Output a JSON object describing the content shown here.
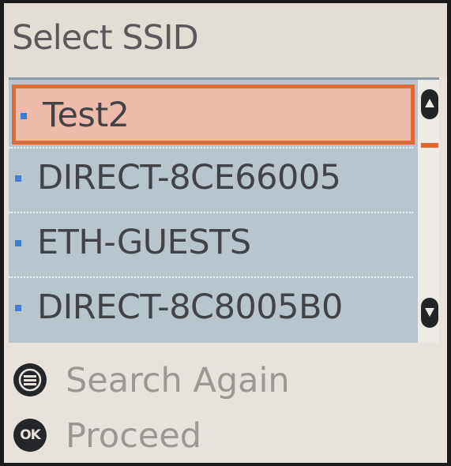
{
  "header": {
    "title": "Select SSID"
  },
  "ssid_list": {
    "items": [
      {
        "label": "Test2",
        "selected": true
      },
      {
        "label": "DIRECT-8CE66005",
        "selected": false
      },
      {
        "label": "ETH-GUESTS",
        "selected": false
      },
      {
        "label": "DIRECT-8C8005B0",
        "selected": false
      }
    ],
    "bullet_color": "#3f7fcf",
    "selection_color": "#e06a33",
    "scroll_up_icon": "triangle-up-icon",
    "scroll_down_icon": "triangle-down-icon"
  },
  "actions": [
    {
      "label": "Search Again",
      "icon": "menu-circle-icon"
    },
    {
      "label": "Proceed",
      "icon": "ok-button-icon",
      "icon_text": "OK"
    }
  ]
}
